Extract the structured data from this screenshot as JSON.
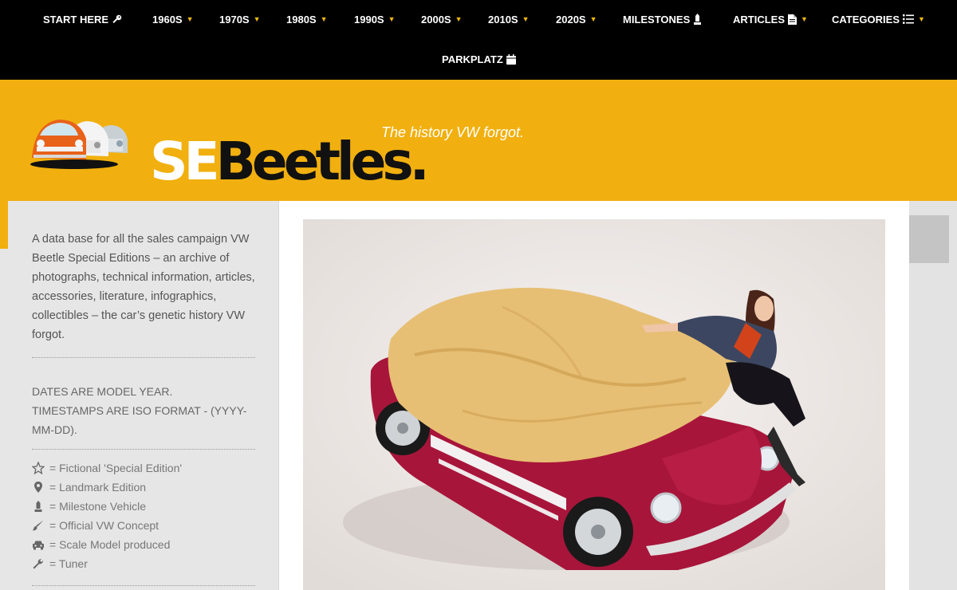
{
  "nav": {
    "items": [
      {
        "label": "START HERE",
        "icon": "key-icon",
        "dropdown": false
      },
      {
        "label": "1960S",
        "dropdown": true
      },
      {
        "label": "1970S",
        "dropdown": true
      },
      {
        "label": "1980S",
        "dropdown": true
      },
      {
        "label": "1990S",
        "dropdown": true
      },
      {
        "label": "2000S",
        "dropdown": true
      },
      {
        "label": "2010S",
        "dropdown": true
      },
      {
        "label": "2020S",
        "dropdown": true
      },
      {
        "label": "MILESTONES",
        "icon": "milestone-icon",
        "dropdown": false
      },
      {
        "label": "ARTICLES",
        "icon": "document-icon",
        "dropdown": true
      },
      {
        "label": "CATEGORIES",
        "icon": "list-icon",
        "dropdown": true
      },
      {
        "label": "PARKPLATZ",
        "icon": "calendar-icon",
        "dropdown": false
      }
    ],
    "accent_color": "#f0b90f"
  },
  "header": {
    "logo_se": "SE",
    "logo_beetles": "Beetles.",
    "tagline": "The history VW forgot.",
    "background_color": "#f1b00f"
  },
  "sidebar": {
    "intro": "A data base for all the sales campaign VW Beetle Special Editions – an archive of photographs, technical information, articles, accessories, literature, infographics, collectibles – the car’s genetic history VW forgot.",
    "dates_line1": "DATES ARE MODEL YEAR.",
    "dates_line2": "TIMESTAMPS ARE ISO FORMAT - (YYYY-MM-DD).",
    "legend": [
      {
        "icon": "star-icon",
        "text": "= Fictional 'Special Edition'"
      },
      {
        "icon": "map-marker-icon",
        "text": "= Landmark Edition"
      },
      {
        "icon": "milestone-icon",
        "text": "= Milestone Vehicle"
      },
      {
        "icon": "paint-brush-icon",
        "text": "= Official VW Concept"
      },
      {
        "icon": "car-icon",
        "text": "= Scale Model produced"
      },
      {
        "icon": "wrench-icon",
        "text": "= Tuner"
      }
    ]
  },
  "main": {
    "hero_image": "Red VW Beetle convertible with a tan cover being pulled off by a woman"
  }
}
